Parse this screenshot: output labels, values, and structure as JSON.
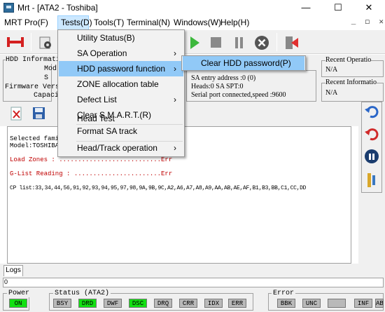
{
  "window": {
    "title": "Mrt - [ATA2 - Toshiba]",
    "minimize": "—",
    "maximize": "☐",
    "close": "✕"
  },
  "menubar": {
    "items": [
      "MRT Pro(F)",
      "Tests(D)",
      "Tools(T)",
      "Terminal(N)",
      "Windows(W)",
      "Help(H)"
    ],
    "mdi_controls": "_  ◻  ✕"
  },
  "tests_menu": {
    "items": [
      {
        "label": "Utility Status(B)",
        "submenu": false
      },
      {
        "label": "SA Operation",
        "submenu": true
      },
      {
        "label": "HDD password function",
        "submenu": true,
        "highlighted": true
      },
      {
        "label": "ZONE allocation table",
        "submenu": false
      },
      {
        "label": "Defect List",
        "submenu": true
      },
      {
        "label": "Clear S.M.A.R.T.(R)",
        "submenu": false
      },
      {
        "label": "Head Test",
        "submenu": false
      },
      {
        "label": "Format SA track",
        "submenu": false
      },
      {
        "label": "Head/Track operation",
        "submenu": true
      }
    ],
    "arrow": "›"
  },
  "password_submenu": {
    "items": [
      "Clear HDD password(P)"
    ]
  },
  "hdd_info": {
    "group_label": "HDD Informati",
    "model_label": "Mod",
    "s_label": "S",
    "firmware_label": "Firmware Versi",
    "capacity_label": "Capaci"
  },
  "sa_info": {
    "sa_entry": "SA entry address :0 (0)",
    "heads": "Heads:0 SA SPT:0",
    "serial": "Serial port connected,speed :9600"
  },
  "recent_operation": {
    "label": "Recent Operatio",
    "value": "N/A"
  },
  "recent_info": {
    "label": "Recent Informatio",
    "value": "N/A"
  },
  "log": {
    "lines": [
      {
        "text": "Selected fami",
        "color": "#000000"
      },
      {
        "text": "Model:TOSHIBA",
        "color": "#000000"
      },
      {
        "text": "Load Zones : ...........................Err",
        "color": "#c00000"
      },
      {
        "text": "G-List Reading : .......................Err",
        "color": "#c00000"
      },
      {
        "text": "CP list:33,34,44,56,91,92,93,94,95,97,98,9A,9B,9C,A2,A6,A7,A8,A9,AA,AB,AE,AF,B1,B3,BB,C1,CC,DD",
        "color": "#000000"
      }
    ],
    "tab_label": "Logs",
    "progress_value": "0"
  },
  "status": {
    "power_label": "Power",
    "power_led": "ON",
    "status_label": "Status (ATA2)",
    "status_leds": [
      {
        "label": "BSY",
        "on": false
      },
      {
        "label": "DRD",
        "on": true
      },
      {
        "label": "DWF",
        "on": false
      },
      {
        "label": "DSC",
        "on": true
      },
      {
        "label": "DRQ",
        "on": false
      },
      {
        "label": "CRR",
        "on": false
      },
      {
        "label": "IDX",
        "on": false
      },
      {
        "label": "ERR",
        "on": false
      }
    ],
    "error_label": "Error",
    "error_leds": [
      "BBK",
      "UNC",
      "",
      "INF",
      "ABR"
    ]
  },
  "colors": {
    "accent": "#91c9f7",
    "led_on": "#12e012",
    "led_off": "#b9b9b9",
    "error_text": "#c00000"
  }
}
